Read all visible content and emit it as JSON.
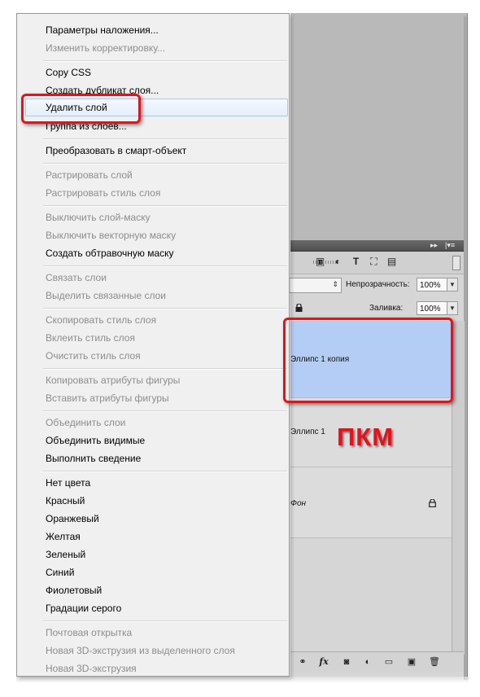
{
  "context_menu": {
    "items": [
      {
        "label": "Параметры наложения...",
        "enabled": true
      },
      {
        "label": "Изменить корректировку...",
        "enabled": false
      },
      {
        "label": "Copy CSS",
        "enabled": true
      },
      {
        "label": "Создать дубликат слоя...",
        "enabled": true
      },
      {
        "label": "Удалить слой",
        "enabled": true,
        "highlighted": true
      },
      {
        "label": "Группа из слоев...",
        "enabled": true
      },
      {
        "label": "Преобразовать в смарт-объект",
        "enabled": true
      },
      {
        "label": "Растрировать слой",
        "enabled": false
      },
      {
        "label": "Растрировать стиль слоя",
        "enabled": false
      },
      {
        "label": "Выключить слой-маску",
        "enabled": false
      },
      {
        "label": "Выключить векторную маску",
        "enabled": false
      },
      {
        "label": "Создать обтравочную маску",
        "enabled": true
      },
      {
        "label": "Связать слои",
        "enabled": false
      },
      {
        "label": "Выделить связанные слои",
        "enabled": false
      },
      {
        "label": "Скопировать стиль слоя",
        "enabled": false
      },
      {
        "label": "Вклеить стиль слоя",
        "enabled": false
      },
      {
        "label": "Очистить стиль слоя",
        "enabled": false
      },
      {
        "label": "Копировать атрибуты фигуры",
        "enabled": false
      },
      {
        "label": "Вставить атрибуты фигуры",
        "enabled": false
      },
      {
        "label": "Объединить слои",
        "enabled": false
      },
      {
        "label": "Объединить видимые",
        "enabled": true
      },
      {
        "label": "Выполнить сведение",
        "enabled": true
      },
      {
        "label": "Нет цвета",
        "enabled": true
      },
      {
        "label": "Красный",
        "enabled": true
      },
      {
        "label": "Оранжевый",
        "enabled": true
      },
      {
        "label": "Желтая",
        "enabled": true
      },
      {
        "label": "Зеленый",
        "enabled": true
      },
      {
        "label": "Синий",
        "enabled": true
      },
      {
        "label": "Фиолетовый",
        "enabled": true
      },
      {
        "label": "Градации серого",
        "enabled": true
      },
      {
        "label": "Почтовая открытка",
        "enabled": false
      },
      {
        "label": "Новая 3D-экструзия из выделенного слоя",
        "enabled": false
      },
      {
        "label": "Новая 3D-экструзия",
        "enabled": false
      }
    ]
  },
  "layers_panel": {
    "opacity_label": "Непрозрачность:",
    "opacity_value": "100%",
    "fill_label": "Заливка:",
    "fill_value": "100%",
    "layers": [
      {
        "name": "Эллипс 1 копия",
        "selected": true
      },
      {
        "name": "Эллипс 1",
        "selected": false
      },
      {
        "name": "Фон",
        "selected": false,
        "locked": true
      }
    ]
  },
  "annotation": {
    "text": "ПКМ",
    "color": "#e4121a"
  },
  "colors": {
    "highlight_outline": "#e0141a",
    "selected_layer": "#b4cdf4"
  }
}
